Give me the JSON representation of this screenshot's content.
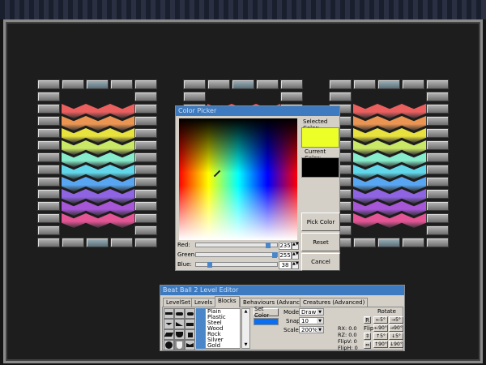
{
  "chevron_colors": [
    "#ec5f5f",
    "#ec9552",
    "#e8e23e",
    "#c9e866",
    "#86eccb",
    "#62d7ea",
    "#58a6f2",
    "#8f64e2",
    "#a656d6",
    "#e45596"
  ],
  "color_picker": {
    "title": "Color Picker",
    "selected_label": "Selected Color:",
    "current_label": "Current Color:",
    "selected_color": "#ecff26",
    "current_color": "#000000",
    "pick_label": "Pick Color",
    "reset_label": "Reset",
    "cancel_label": "Cancel",
    "sliders": [
      {
        "label": "Red:",
        "value": "235",
        "fraction": 0.92
      },
      {
        "label": "Green:",
        "value": "255",
        "fraction": 1.0
      },
      {
        "label": "Blue:",
        "value": "38",
        "fraction": 0.15
      }
    ]
  },
  "editor": {
    "title": "Beat Ball 2 Level Editor",
    "tabs": [
      "LevelSet",
      "Levels",
      "Blocks",
      "Behaviours (Advanced)",
      "Creatures (Advanced)"
    ],
    "active_tab": "Blocks",
    "materials": [
      "Plain",
      "Plastic",
      "Steel",
      "Wood",
      "Rock",
      "Silver",
      "Gold"
    ],
    "set_color_label": "Set Color",
    "block_color": "#0a6ef0",
    "mode_label": "Mode",
    "mode_value": "Draw",
    "snap_label": "Snap",
    "snap_value": "10",
    "scale_label": "Scale",
    "scale_value": "200%",
    "readouts": [
      "RX: 0.0",
      "RZ: 0.0",
      "FlipV: 0",
      "FlipH: 0"
    ],
    "rotate_label": "Rotate",
    "flip_label": "Flip",
    "reset_rot": "R",
    "rotate_buttons": [
      "←5°",
      "→5°",
      "←90°",
      "→90°",
      "↑5°",
      "↓5°",
      "↑90°",
      "↓90°"
    ]
  }
}
